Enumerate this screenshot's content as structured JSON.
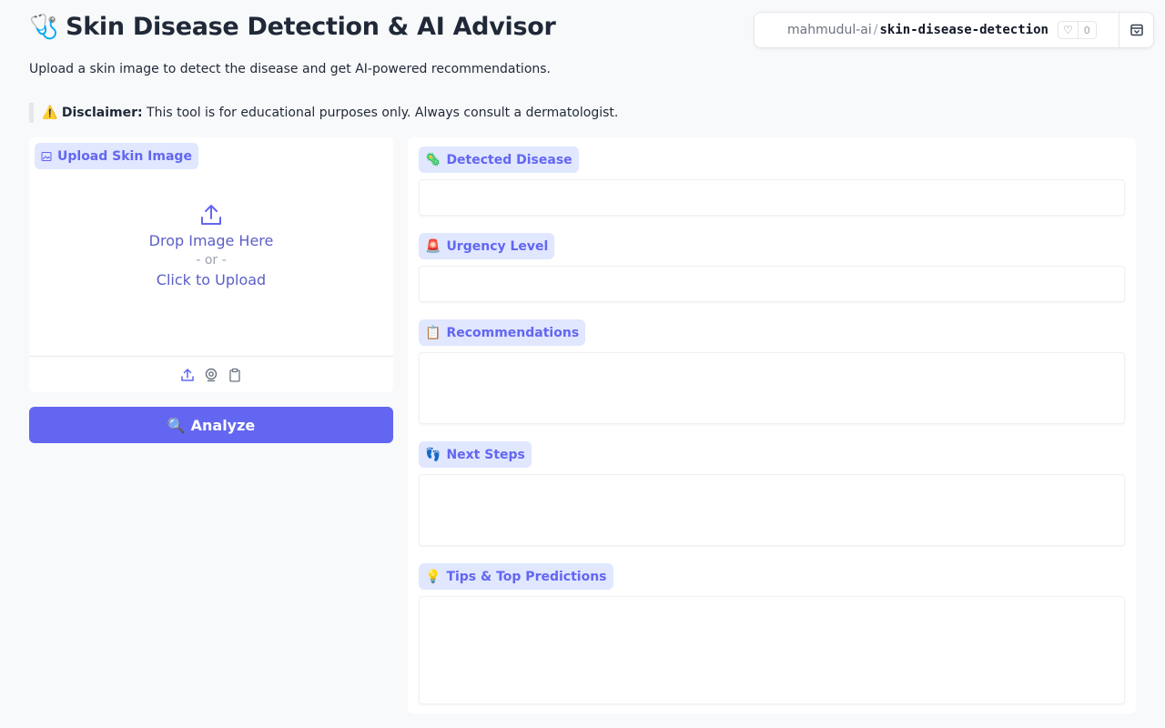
{
  "header": {
    "title_emoji": "🩺",
    "title": "Skin Disease Detection & AI Advisor",
    "subtitle": "Upload a skin image to detect the disease and get AI-powered recommendations.",
    "disclaimer_emoji": "⚠️",
    "disclaimer_label": "Disclaimer:",
    "disclaimer_text": " This tool is for educational purposes only. Always consult a dermatologist."
  },
  "space": {
    "owner": "mahmudul-ai",
    "repo": "skin-disease-detection",
    "likes": "0"
  },
  "upload": {
    "label": "Upload Skin Image",
    "drop_text": "Drop Image Here",
    "or_text": "- or -",
    "click_text": "Click to Upload"
  },
  "analyze": {
    "emoji": "🔍",
    "label": "Analyze"
  },
  "outputs": [
    {
      "emoji": "🦠",
      "label": "Detected Disease",
      "value": ""
    },
    {
      "emoji": "🚨",
      "label": "Urgency Level",
      "value": ""
    },
    {
      "emoji": "📋",
      "label": "Recommendations",
      "value": ""
    },
    {
      "emoji": "👣",
      "label": "Next Steps",
      "value": ""
    },
    {
      "emoji": "💡",
      "label": "Tips & Top Predictions",
      "value": ""
    }
  ],
  "colors": {
    "accent": "#6366f1",
    "label_bg": "#e0e7ff",
    "background": "#f8f9fb"
  }
}
